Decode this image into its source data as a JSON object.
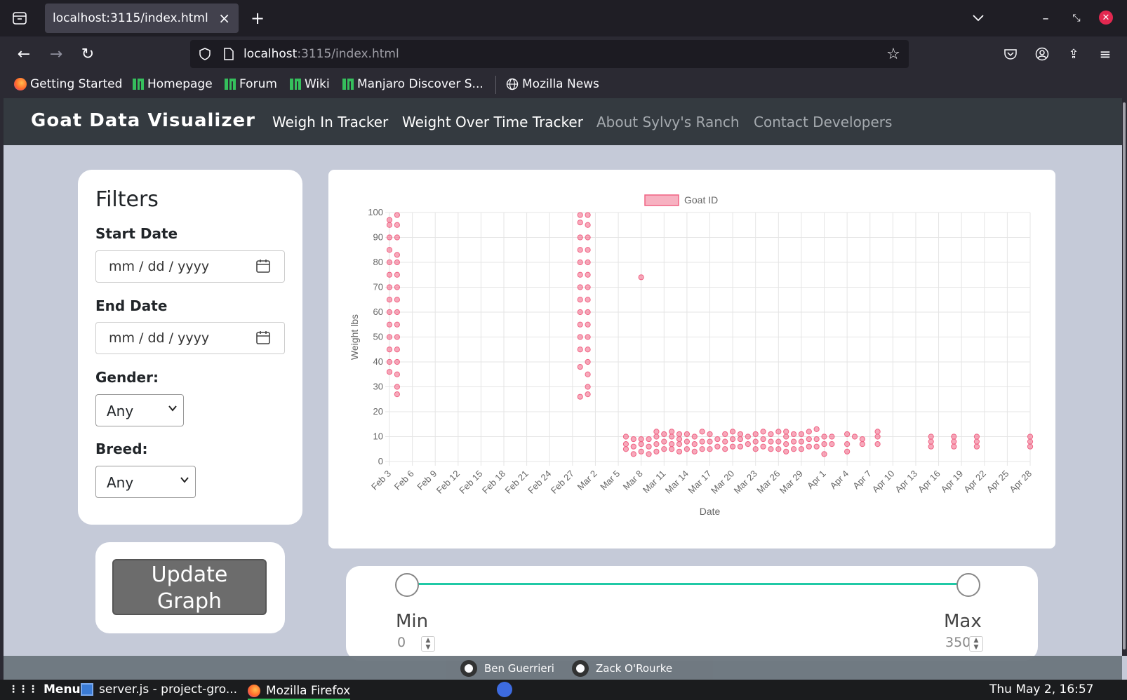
{
  "browser": {
    "tab_title": "localhost:3115/index.html",
    "url_host": "localhost",
    "url_rest": ":3115/index.html",
    "bookmarks": [
      "Getting Started",
      "Homepage",
      "Forum",
      "Wiki",
      "Manjaro Discover S...",
      "Mozilla News"
    ]
  },
  "site": {
    "brand": "Goat Data Visualizer",
    "nav": [
      {
        "label": "Weigh In Tracker",
        "color": "#ffffff"
      },
      {
        "label": "Weight Over Time Tracker",
        "color": "#ffffff"
      },
      {
        "label": "About Sylvy's Ranch",
        "color": "#a4a9ae"
      },
      {
        "label": "Contact Developers",
        "color": "#a4a9ae"
      }
    ]
  },
  "filters": {
    "title": "Filters",
    "start_label": "Start Date",
    "start_placeholder": "mm / dd / yyyy",
    "end_label": "End Date",
    "end_placeholder": "mm / dd / yyyy",
    "gender_label": "Gender:",
    "gender_value": "Any",
    "breed_label": "Breed:",
    "breed_value": "Any"
  },
  "update": {
    "label_line1": "Update",
    "label_line2": "Graph"
  },
  "slider": {
    "min_label": "Min",
    "max_label": "Max",
    "min_value": "0",
    "max_value": "350",
    "range_min": 0,
    "range_max": 350,
    "accent": "#20c9a6"
  },
  "footer": {
    "authors": [
      "Ben Guerrieri",
      "Zack O'Rourke"
    ]
  },
  "taskbar": {
    "menu": "Menu",
    "items": [
      "server.js - project-gro...",
      "Mozilla Firefox"
    ],
    "clock": "Thu May  2, 16:57"
  },
  "chart_data": {
    "type": "scatter",
    "legend": "Goat ID",
    "legend_position": "top",
    "xlabel": "Date",
    "ylabel": "Weight lbs",
    "ylim": [
      0,
      100
    ],
    "yticks": [
      0,
      10,
      20,
      30,
      40,
      50,
      60,
      70,
      80,
      90,
      100
    ],
    "xticks": [
      "Feb 3",
      "Feb 6",
      "Feb 9",
      "Feb 12",
      "Feb 15",
      "Feb 18",
      "Feb 21",
      "Feb 24",
      "Feb 27",
      "Mar 2",
      "Mar 5",
      "Mar 8",
      "Mar 11",
      "Mar 14",
      "Mar 17",
      "Mar 20",
      "Mar 23",
      "Mar 26",
      "Mar 29",
      "Apr 1",
      "Apr 4",
      "Apr 7",
      "Apr 10",
      "Apr 13",
      "Apr 16",
      "Apr 19",
      "Apr 22",
      "Apr 25",
      "Apr 28"
    ],
    "grid": true,
    "color": "#f06384",
    "series": [
      {
        "points": [
          [
            "Feb 3",
            36
          ],
          [
            "Feb 3",
            40
          ],
          [
            "Feb 3",
            45
          ],
          [
            "Feb 3",
            50
          ],
          [
            "Feb 3",
            55
          ],
          [
            "Feb 3",
            60
          ],
          [
            "Feb 3",
            65
          ],
          [
            "Feb 3",
            70
          ],
          [
            "Feb 3",
            75
          ],
          [
            "Feb 3",
            80
          ],
          [
            "Feb 3",
            85
          ],
          [
            "Feb 3",
            90
          ],
          [
            "Feb 3",
            95
          ],
          [
            "Feb 3",
            97
          ],
          [
            "Feb 4",
            27
          ],
          [
            "Feb 4",
            30
          ],
          [
            "Feb 4",
            35
          ],
          [
            "Feb 4",
            40
          ],
          [
            "Feb 4",
            45
          ],
          [
            "Feb 4",
            50
          ],
          [
            "Feb 4",
            55
          ],
          [
            "Feb 4",
            60
          ],
          [
            "Feb 4",
            65
          ],
          [
            "Feb 4",
            70
          ],
          [
            "Feb 4",
            75
          ],
          [
            "Feb 4",
            80
          ],
          [
            "Feb 4",
            83
          ],
          [
            "Feb 4",
            90
          ],
          [
            "Feb 4",
            95
          ],
          [
            "Feb 4",
            99
          ],
          [
            "Feb 28",
            26
          ],
          [
            "Feb 28",
            38
          ],
          [
            "Feb 28",
            45
          ],
          [
            "Feb 28",
            50
          ],
          [
            "Feb 28",
            55
          ],
          [
            "Feb 28",
            60
          ],
          [
            "Feb 28",
            65
          ],
          [
            "Feb 28",
            70
          ],
          [
            "Feb 28",
            75
          ],
          [
            "Feb 28",
            80
          ],
          [
            "Feb 28",
            85
          ],
          [
            "Feb 28",
            90
          ],
          [
            "Feb 28",
            96
          ],
          [
            "Feb 28",
            99
          ],
          [
            "Mar 1",
            27
          ],
          [
            "Mar 1",
            30
          ],
          [
            "Mar 1",
            35
          ],
          [
            "Mar 1",
            40
          ],
          [
            "Mar 1",
            45
          ],
          [
            "Mar 1",
            50
          ],
          [
            "Mar 1",
            55
          ],
          [
            "Mar 1",
            60
          ],
          [
            "Mar 1",
            65
          ],
          [
            "Mar 1",
            70
          ],
          [
            "Mar 1",
            75
          ],
          [
            "Mar 1",
            80
          ],
          [
            "Mar 1",
            85
          ],
          [
            "Mar 1",
            90
          ],
          [
            "Mar 1",
            95
          ],
          [
            "Mar 1",
            99
          ],
          [
            "Mar 6",
            5
          ],
          [
            "Mar 6",
            7
          ],
          [
            "Mar 6",
            10
          ],
          [
            "Mar 7",
            3
          ],
          [
            "Mar 7",
            6
          ],
          [
            "Mar 7",
            9
          ],
          [
            "Mar 8",
            4
          ],
          [
            "Mar 8",
            7
          ],
          [
            "Mar 8",
            9
          ],
          [
            "Mar 8",
            74
          ],
          [
            "Mar 9",
            3
          ],
          [
            "Mar 9",
            6
          ],
          [
            "Mar 9",
            9
          ],
          [
            "Mar 10",
            4
          ],
          [
            "Mar 10",
            7
          ],
          [
            "Mar 10",
            10
          ],
          [
            "Mar 10",
            12
          ],
          [
            "Mar 11",
            5
          ],
          [
            "Mar 11",
            8
          ],
          [
            "Mar 11",
            11
          ],
          [
            "Mar 12",
            5
          ],
          [
            "Mar 12",
            7
          ],
          [
            "Mar 12",
            10
          ],
          [
            "Mar 12",
            12
          ],
          [
            "Mar 13",
            4
          ],
          [
            "Mar 13",
            7
          ],
          [
            "Mar 13",
            9
          ],
          [
            "Mar 13",
            11
          ],
          [
            "Mar 14",
            5
          ],
          [
            "Mar 14",
            8
          ],
          [
            "Mar 14",
            11
          ],
          [
            "Mar 15",
            4
          ],
          [
            "Mar 15",
            7
          ],
          [
            "Mar 15",
            10
          ],
          [
            "Mar 16",
            5
          ],
          [
            "Mar 16",
            8
          ],
          [
            "Mar 16",
            12
          ],
          [
            "Mar 17",
            5
          ],
          [
            "Mar 17",
            8
          ],
          [
            "Mar 17",
            11
          ],
          [
            "Mar 18",
            6
          ],
          [
            "Mar 18",
            9
          ],
          [
            "Mar 19",
            5
          ],
          [
            "Mar 19",
            8
          ],
          [
            "Mar 19",
            11
          ],
          [
            "Mar 20",
            6
          ],
          [
            "Mar 20",
            9
          ],
          [
            "Mar 20",
            12
          ],
          [
            "Mar 21",
            6
          ],
          [
            "Mar 21",
            9
          ],
          [
            "Mar 21",
            11
          ],
          [
            "Mar 22",
            7
          ],
          [
            "Mar 22",
            10
          ],
          [
            "Mar 23",
            5
          ],
          [
            "Mar 23",
            8
          ],
          [
            "Mar 23",
            11
          ],
          [
            "Mar 24",
            6
          ],
          [
            "Mar 24",
            9
          ],
          [
            "Mar 24",
            12
          ],
          [
            "Mar 25",
            5
          ],
          [
            "Mar 25",
            8
          ],
          [
            "Mar 25",
            11
          ],
          [
            "Mar 26",
            5
          ],
          [
            "Mar 26",
            8
          ],
          [
            "Mar 26",
            12
          ],
          [
            "Mar 27",
            4
          ],
          [
            "Mar 27",
            7
          ],
          [
            "Mar 27",
            10
          ],
          [
            "Mar 27",
            12
          ],
          [
            "Mar 28",
            5
          ],
          [
            "Mar 28",
            8
          ],
          [
            "Mar 28",
            11
          ],
          [
            "Mar 29",
            5
          ],
          [
            "Mar 29",
            8
          ],
          [
            "Mar 29",
            11
          ],
          [
            "Mar 30",
            6
          ],
          [
            "Mar 30",
            9
          ],
          [
            "Mar 30",
            12
          ],
          [
            "Mar 31",
            6
          ],
          [
            "Mar 31",
            9
          ],
          [
            "Mar 31",
            13
          ],
          [
            "Apr 1",
            3
          ],
          [
            "Apr 1",
            7
          ],
          [
            "Apr 1",
            10
          ],
          [
            "Apr 2",
            7
          ],
          [
            "Apr 2",
            10
          ],
          [
            "Apr 4",
            4
          ],
          [
            "Apr 4",
            7
          ],
          [
            "Apr 4",
            11
          ],
          [
            "Apr 5",
            10
          ],
          [
            "Apr 6",
            7
          ],
          [
            "Apr 6",
            9
          ],
          [
            "Apr 8",
            7
          ],
          [
            "Apr 8",
            10
          ],
          [
            "Apr 8",
            12
          ],
          [
            "Apr 15",
            6
          ],
          [
            "Apr 15",
            8
          ],
          [
            "Apr 15",
            10
          ],
          [
            "Apr 18",
            6
          ],
          [
            "Apr 18",
            8
          ],
          [
            "Apr 18",
            10
          ],
          [
            "Apr 21",
            6
          ],
          [
            "Apr 21",
            8
          ],
          [
            "Apr 21",
            10
          ],
          [
            "Apr 28",
            6
          ],
          [
            "Apr 28",
            8
          ],
          [
            "Apr 28",
            10
          ]
        ]
      }
    ]
  }
}
